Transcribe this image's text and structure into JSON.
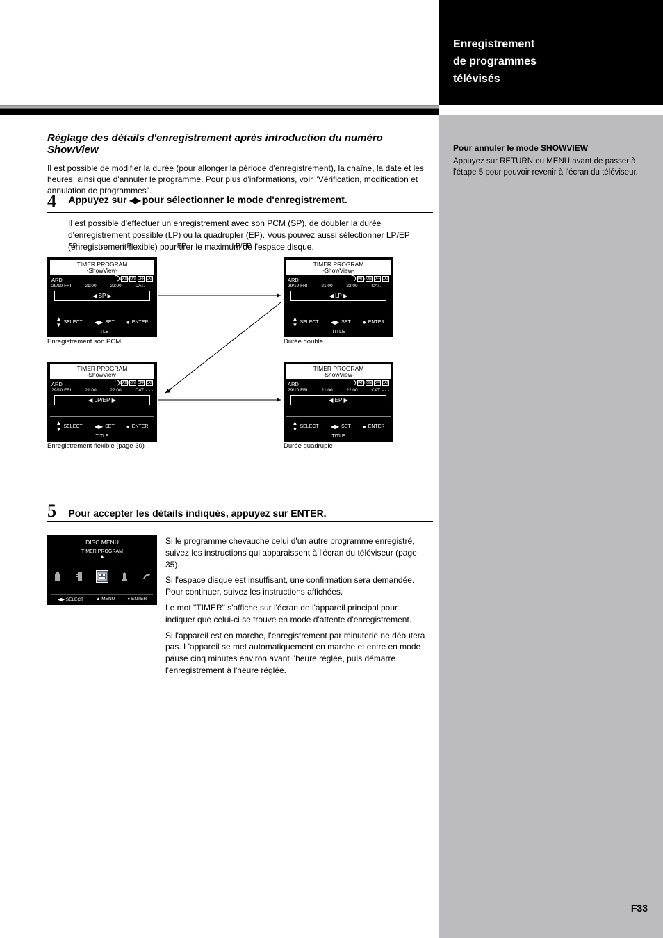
{
  "header": {
    "line1": "Enregistrement",
    "line2": "de programmes",
    "line3": "télévisés"
  },
  "sidebar": {
    "heading": "Pour annuler le mode SHOWVIEW",
    "body": "Appuyez sur RETURN ou MENU avant de passer à l'étape 5 pour pouvoir revenir à l'écran du téléviseur."
  },
  "page_number": "F33",
  "intro": {
    "heading": "Réglage des détails d'enregistrement après introduction du numéro ShowView",
    "body": "Il est possible de modifier la durée (pour allonger la période d'enregistrement), la chaîne, la date et les heures, ainsi que d'annuler le programme. Pour plus d'informations, voir \"Vérification, modification et annulation de programmes\"."
  },
  "step4": {
    "num": "4",
    "title_before_arrows": "Appuyez sur ",
    "title_after_arrows": " pour sélectionner le mode d'enregistrement.",
    "body": "Il est possible d'effectuer un enregistrement avec son PCM (SP), de doubler la durée d'enregistrement possible (LP) ou la quadrupler (EP). Vous pouvez aussi sélectionner LP/EP (enregistrement flexible) pour tirer le maximum de l'espace disque."
  },
  "flow": {
    "sp": "SP",
    "lp": "LP",
    "ep": "EP",
    "lpep": "LP/EP"
  },
  "panels": {
    "title_line1": "TIMER PROGRAM",
    "title_line2": "-ShowView-",
    "channel": "ARD",
    "i_date": "DATE",
    "i_on": "ON",
    "i_off": "OFF",
    "i_cat": "CAT.",
    "date": "29/10 FRI",
    "on": "21:00",
    "off": "22:00",
    "cat_label": "CAT.",
    "cat_val": "- - -",
    "mode_sp": "SP",
    "mode_lp": "LP",
    "mode_ep": "EP",
    "mode_lpep": "LP/EP",
    "btn_select": "SELECT",
    "btn_set": "SET",
    "btn_enter": "ENTER",
    "btn_title": "TITLE",
    "cap_sp": "Enregistrement son PCM",
    "cap_lp": "Durée double",
    "cap_ep": "Durée quadruple",
    "cap_lpep": "Enregistrement flexible (page 30)"
  },
  "step5": {
    "num": "5",
    "title": "Pour accepter les détails indiqués, appuyez sur ENTER.",
    "menu_title": "DISC MENU",
    "menu_item": "TIMER PROGRAM",
    "btn_select": "SELECT",
    "btn_menu": "MENU",
    "btn_enter": "ENTER",
    "body_p1": "Si le programme chevauche celui d'un autre programme enregistré, suivez les instructions qui apparaissent à l'écran du téléviseur (page 35).",
    "body_p2": "Si l'espace disque est insuffisant, une confirmation sera demandée. Pour continuer, suivez les instructions affichées.",
    "body_p3": "Le mot \"TIMER\" s'affiche sur l'écran de l'appareil principal pour indiquer que celui-ci se trouve en mode d'attente d'enregistrement.",
    "body_p4": "Si l'appareil est en marche, l'enregistrement par minuterie ne débutera pas. L'appareil se met automatiquement en marche et entre en mode pause cinq minutes environ avant l'heure réglée, puis démarre l'enregistrement à l'heure réglée."
  }
}
